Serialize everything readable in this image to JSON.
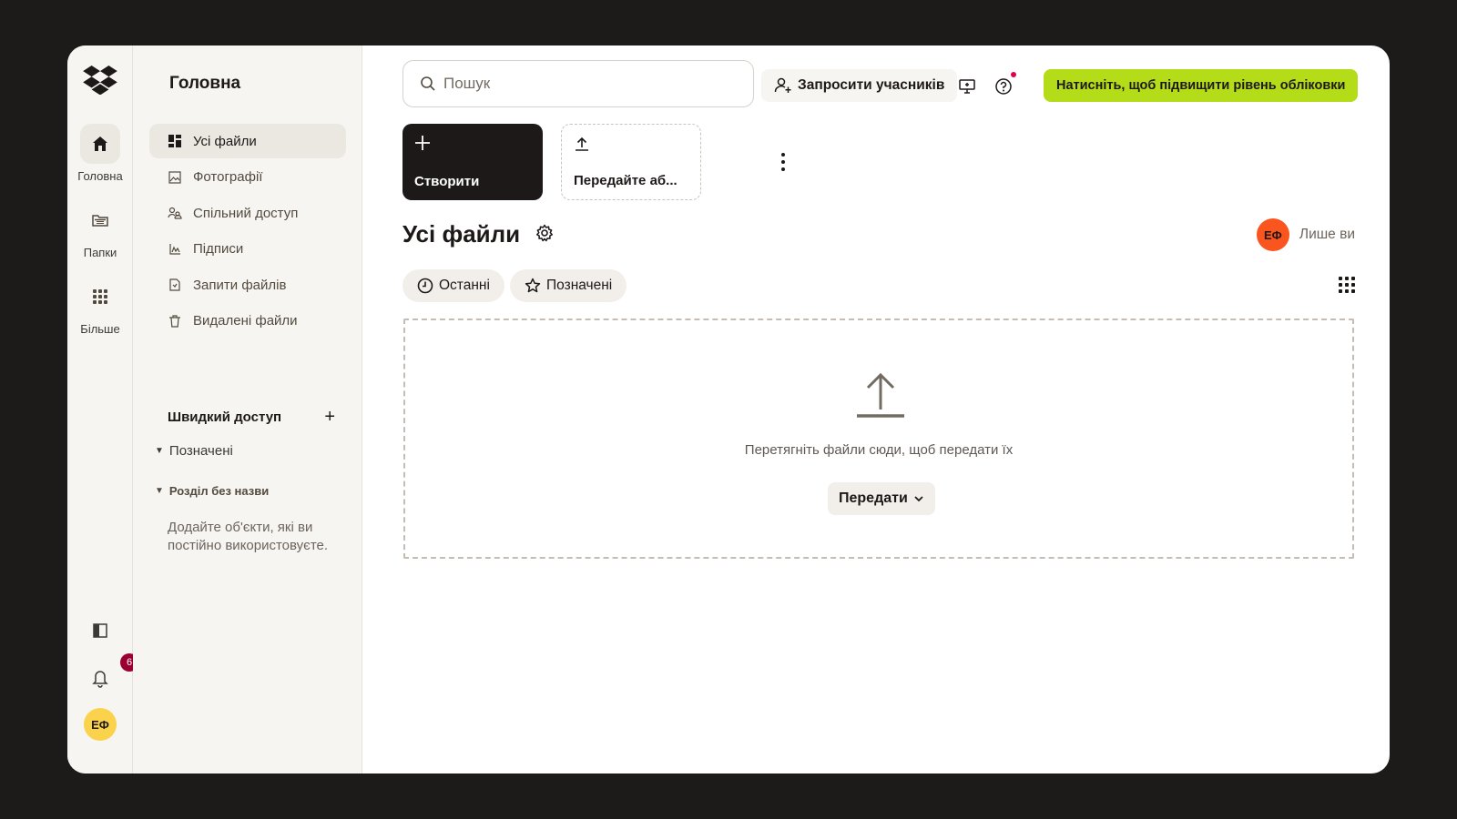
{
  "rail": {
    "items": [
      {
        "label": "Головна",
        "icon": "home-icon"
      },
      {
        "label": "Папки",
        "icon": "folder-icon"
      },
      {
        "label": "Більше",
        "icon": "apps-grid-icon"
      }
    ],
    "notification_count": "6",
    "user_initials": "ЕФ"
  },
  "nav": {
    "title": "Головна",
    "items": [
      {
        "label": "Усі файли",
        "icon": "all-files-icon"
      },
      {
        "label": "Фотографії",
        "icon": "photo-icon"
      },
      {
        "label": "Спільний доступ",
        "icon": "shared-icon"
      },
      {
        "label": "Підписи",
        "icon": "signature-icon"
      },
      {
        "label": "Запити файлів",
        "icon": "file-request-icon"
      },
      {
        "label": "Видалені файли",
        "icon": "trash-icon"
      }
    ],
    "quick_access": "Швидкий доступ",
    "starred_section": "Позначені",
    "untitled_section": "Розділ без назви",
    "hint": "Додайте об'єкти, які ви постійно використовуєте."
  },
  "topbar": {
    "search_placeholder": "Пошук",
    "invite_label": "Запросити учасників",
    "upgrade_label": "Натисніть, щоб підвищити рівень обліковки"
  },
  "actions": {
    "create_label": "Створити",
    "upload_label": "Передайте аб..."
  },
  "content": {
    "title": "Усі файли",
    "owner_initials": "ЕФ",
    "owner_label": "Лише ви",
    "chips": [
      "Останні",
      "Позначені"
    ],
    "drop_text": "Перетягніть файли сюди, щоб передати їх",
    "upload_button": "Передати"
  },
  "colors": {
    "accent_upgrade": "#b4dc19",
    "avatar_yellow": "#fad24b",
    "avatar_orange": "#fa551e",
    "badge": "#9b0032"
  }
}
